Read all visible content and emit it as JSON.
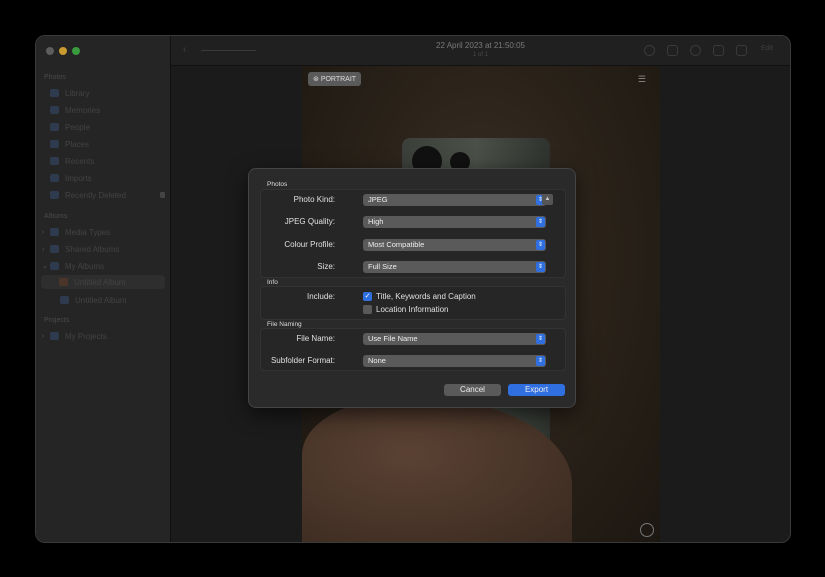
{
  "sidebar": {
    "photos_header": "Photos",
    "items": [
      "Library",
      "Memories",
      "People",
      "Places",
      "Recents",
      "Imports",
      "Recently Deleted"
    ],
    "albums_header": "Albums",
    "albums": [
      "Media Types",
      "Shared Albums",
      "My Albums",
      "Untitled Album",
      "Untitled Album"
    ],
    "projects_header": "Projects",
    "projects": [
      "My Projects"
    ]
  },
  "toolbar": {
    "title": "22 April 2023 at 21:50:05",
    "subtitle": "1 of 1",
    "edit": "Edit"
  },
  "photo": {
    "badge": "PORTRAIT"
  },
  "dialog": {
    "photos_header": "Photos",
    "photo_kind_label": "Photo Kind:",
    "photo_kind": "JPEG",
    "jpeg_quality_label": "JPEG Quality:",
    "jpeg_quality": "High",
    "colour_profile_label": "Colour Profile:",
    "colour_profile": "Most Compatible",
    "size_label": "Size:",
    "size": "Full Size",
    "info_header": "Info",
    "include_label": "Include:",
    "include_title": "Title, Keywords and Caption",
    "include_title_checked": true,
    "include_location": "Location Information",
    "include_location_checked": false,
    "naming_header": "File Naming",
    "file_name_label": "File Name:",
    "file_name": "Use File Name",
    "subfolder_label": "Subfolder Format:",
    "subfolder": "None",
    "cancel": "Cancel",
    "export": "Export"
  },
  "colors": {
    "accent": "#2f6fe0"
  }
}
